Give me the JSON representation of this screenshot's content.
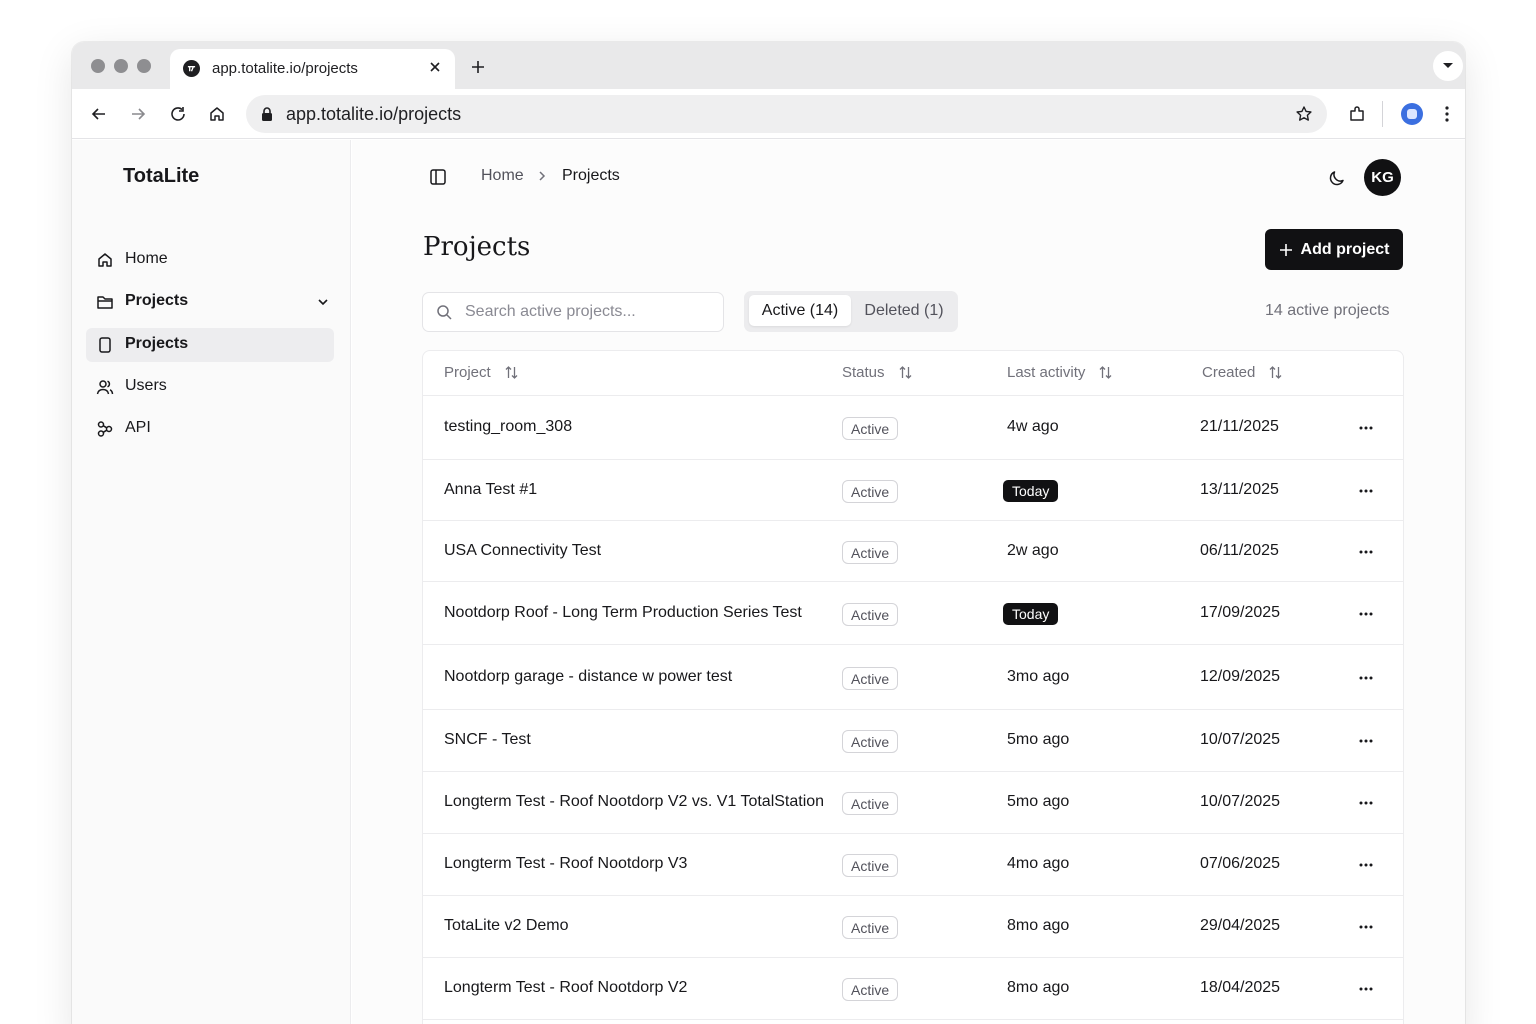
{
  "browser": {
    "tab_title": "app.totalite.io/projects",
    "url": "app.totalite.io/projects"
  },
  "sidebar": {
    "brand": "TotaLite",
    "items": [
      {
        "label": "Home",
        "icon": "home-icon"
      },
      {
        "label": "Projects",
        "icon": "folder-icon"
      },
      {
        "label": "Projects",
        "icon": "tablet-icon"
      },
      {
        "label": "Users",
        "icon": "users-icon"
      },
      {
        "label": "API",
        "icon": "api-icon"
      }
    ]
  },
  "header": {
    "breadcrumb": [
      "Home",
      "Projects"
    ],
    "avatar_initials": "KG"
  },
  "page": {
    "title": "Projects",
    "add_button": "Add project",
    "search_placeholder": "Search active projects...",
    "tabs": {
      "active": "Active (14)",
      "deleted": "Deleted (1)"
    },
    "count_text": "14 active projects"
  },
  "table": {
    "columns": [
      "Project",
      "Status",
      "Last activity",
      "Created"
    ],
    "rows": [
      {
        "name": "testing_room_308",
        "status": "Active",
        "last_activity": "4w ago",
        "today": false,
        "created": "21/11/2025"
      },
      {
        "name": "Anna Test #1",
        "status": "Active",
        "last_activity": "Today",
        "today": true,
        "created": "13/11/2025"
      },
      {
        "name": "USA Connectivity Test",
        "status": "Active",
        "last_activity": "2w ago",
        "today": false,
        "created": "06/11/2025"
      },
      {
        "name": "Nootdorp Roof - Long Term Production Series Test",
        "status": "Active",
        "last_activity": "Today",
        "today": true,
        "created": "17/09/2025"
      },
      {
        "name": "Nootdorp garage - distance w power test",
        "status": "Active",
        "last_activity": "3mo ago",
        "today": false,
        "created": "12/09/2025"
      },
      {
        "name": "SNCF - Test",
        "status": "Active",
        "last_activity": "5mo ago",
        "today": false,
        "created": "10/07/2025"
      },
      {
        "name": "Longterm Test - Roof Nootdorp V2 vs. V1 TotalStation",
        "status": "Active",
        "last_activity": "5mo ago",
        "today": false,
        "created": "10/07/2025"
      },
      {
        "name": "Longterm Test - Roof Nootdorp V3",
        "status": "Active",
        "last_activity": "4mo ago",
        "today": false,
        "created": "07/06/2025"
      },
      {
        "name": "TotaLite v2 Demo",
        "status": "Active",
        "last_activity": "8mo ago",
        "today": false,
        "created": "29/04/2025"
      },
      {
        "name": "Longterm Test - Roof Nootdorp V2",
        "status": "Active",
        "last_activity": "8mo ago",
        "today": false,
        "created": "18/04/2025"
      }
    ]
  },
  "colors": {
    "accent": "#111113",
    "muted_text": "#71717a",
    "border": "#ececee",
    "sidebar_active": "#ededef"
  }
}
